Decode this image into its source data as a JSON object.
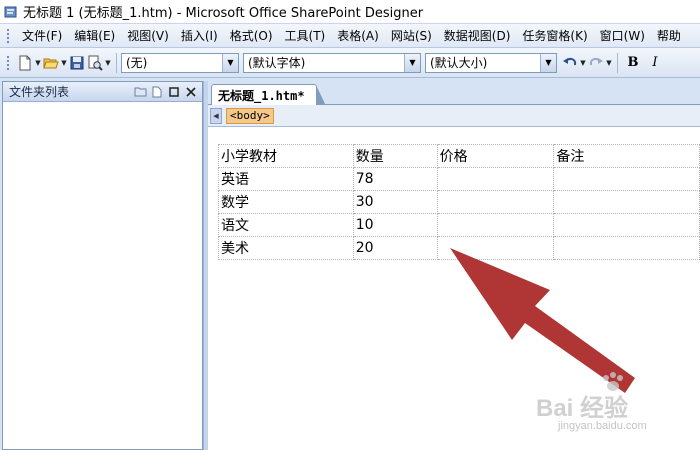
{
  "window": {
    "title": "无标题 1 (无标题_1.htm) - Microsoft Office SharePoint Designer"
  },
  "menu": {
    "items": [
      "文件(F)",
      "编辑(E)",
      "视图(V)",
      "插入(I)",
      "格式(O)",
      "工具(T)",
      "表格(A)",
      "网站(S)",
      "数据视图(D)",
      "任务窗格(K)",
      "窗口(W)",
      "帮助"
    ]
  },
  "toolbar": {
    "style_value": "(无)",
    "font_value": "(默认字体)",
    "size_value": "(默认大小)",
    "bold_label": "B",
    "italic_label": "I"
  },
  "folder_panel": {
    "title": "文件夹列表"
  },
  "document": {
    "tab_label": "无标题_1.htm*",
    "tag_label": "<body>",
    "table": {
      "headers": [
        "小学教材",
        "数量",
        "价格",
        "备注"
      ],
      "rows": [
        [
          "英语",
          "78",
          "",
          ""
        ],
        [
          "数学",
          "30",
          "",
          ""
        ],
        [
          "语文",
          "10",
          "",
          ""
        ],
        [
          "美术",
          "20",
          "",
          ""
        ]
      ]
    }
  },
  "annotation": {
    "arrow_color": "#b03535"
  },
  "watermark": {
    "brand": "Bai 经验",
    "url": "jingyan.baidu.com"
  }
}
